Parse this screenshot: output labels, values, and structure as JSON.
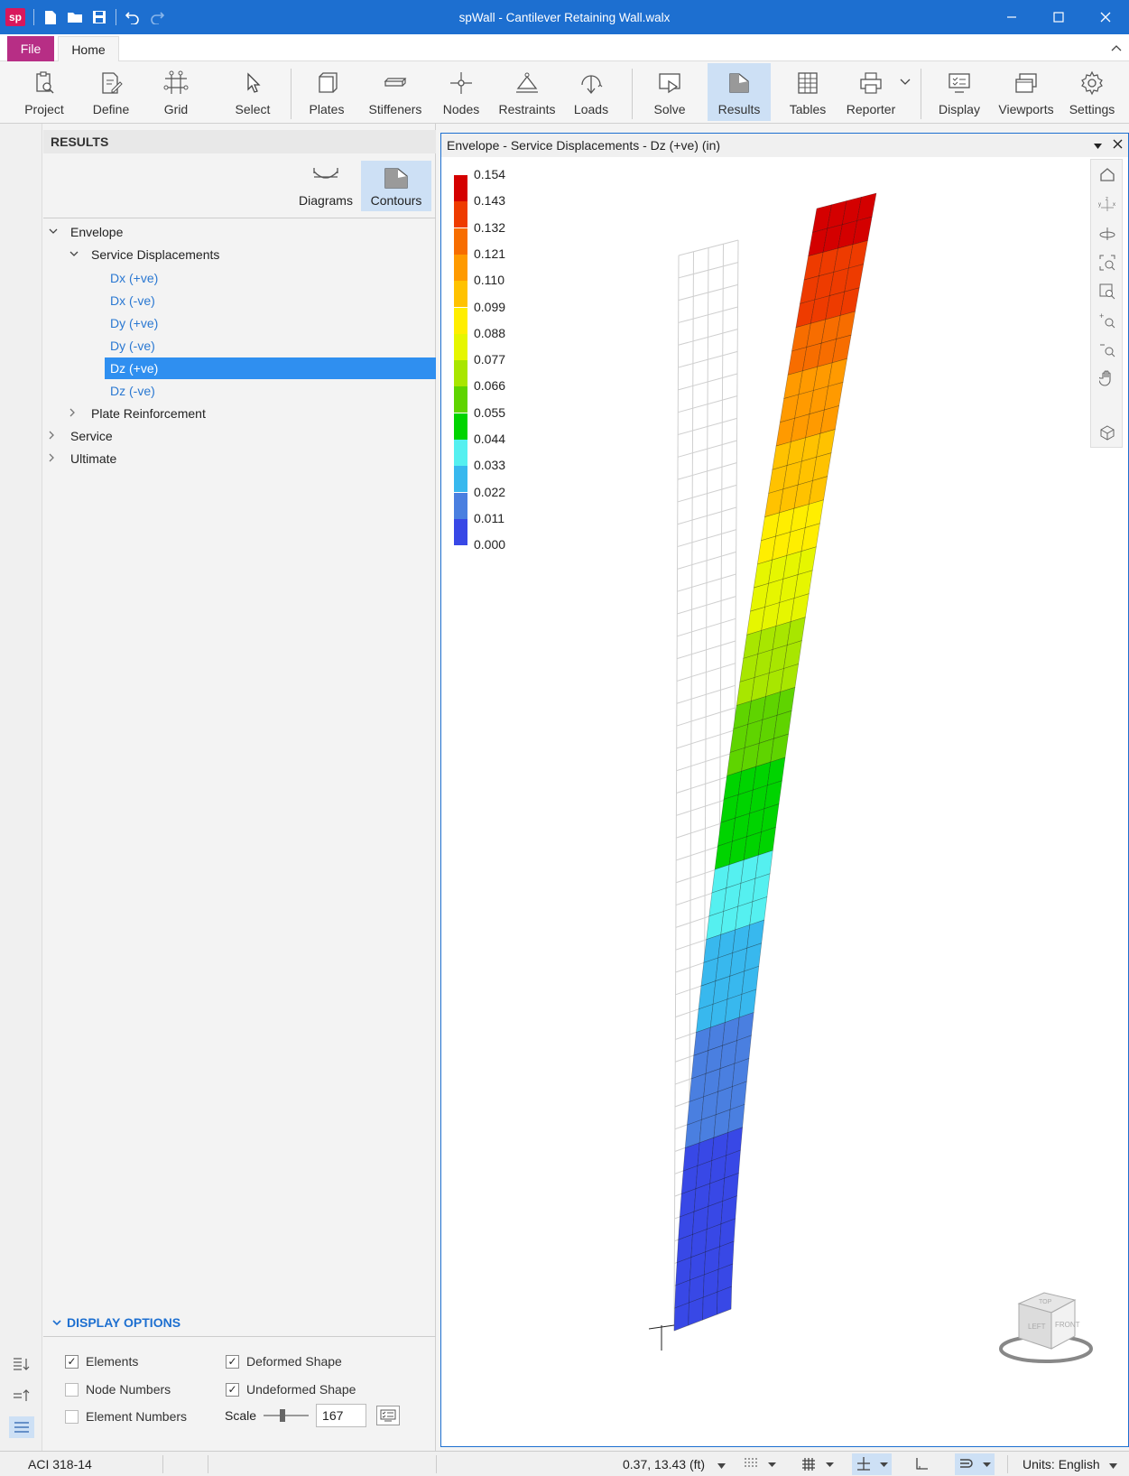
{
  "titlebar": {
    "title": "spWall - Cantilever Retaining Wall.walx",
    "logo": "sp",
    "quick_access_icons": [
      "new-file-icon",
      "open-folder-icon",
      "save-icon",
      "undo-icon",
      "redo-icon"
    ]
  },
  "tabs": {
    "file": "File",
    "home": "Home"
  },
  "ribbon": {
    "buttons": [
      {
        "label": "Project",
        "icon": "clipboard-search-icon"
      },
      {
        "label": "Define",
        "icon": "define-icon"
      },
      {
        "label": "Grid",
        "icon": "grid-icon"
      },
      {
        "label": "Select",
        "icon": "pointer-icon"
      },
      {
        "label": "Plates",
        "icon": "plate-icon"
      },
      {
        "label": "Stiffeners",
        "icon": "stiffener-icon"
      },
      {
        "label": "Nodes",
        "icon": "node-icon"
      },
      {
        "label": "Restraints",
        "icon": "restraint-icon"
      },
      {
        "label": "Loads",
        "icon": "load-icon"
      },
      {
        "label": "Solve",
        "icon": "solve-icon"
      },
      {
        "label": "Results",
        "icon": "results-icon"
      },
      {
        "label": "Tables",
        "icon": "table-icon"
      },
      {
        "label": "Reporter",
        "icon": "printer-icon"
      },
      {
        "label": "Display",
        "icon": "display-icon"
      },
      {
        "label": "Viewports",
        "icon": "viewports-icon"
      },
      {
        "label": "Settings",
        "icon": "gear-icon"
      }
    ],
    "active": "Results"
  },
  "results_panel": {
    "header": "RESULTS",
    "modes": [
      {
        "label": "Diagrams"
      },
      {
        "label": "Contours"
      }
    ],
    "active_mode": "Contours",
    "tree": {
      "envelope": "Envelope",
      "service_displacements": "Service Displacements",
      "leaves": [
        "Dx (+ve)",
        "Dx (-ve)",
        "Dy (+ve)",
        "Dy (-ve)",
        "Dz (+ve)",
        "Dz (-ve)"
      ],
      "selected": "Dz (+ve)",
      "plate_reinforcement": "Plate Reinforcement",
      "service": "Service",
      "ultimate": "Ultimate"
    },
    "display_options": {
      "title": "DISPLAY OPTIONS",
      "elements": {
        "label": "Elements",
        "checked": true
      },
      "node_numbers": {
        "label": "Node Numbers",
        "checked": false
      },
      "element_numbers": {
        "label": "Element Numbers",
        "checked": false
      },
      "deformed_shape": {
        "label": "Deformed Shape",
        "checked": true
      },
      "undeformed_shape": {
        "label": "Undeformed Shape",
        "checked": true
      },
      "scale_label": "Scale",
      "scale_value": "167"
    }
  },
  "viewport": {
    "title": "Envelope - Service Displacements - Dz (+ve) (in)",
    "legend": {
      "values": [
        "0.154",
        "0.143",
        "0.132",
        "0.121",
        "0.110",
        "0.099",
        "0.088",
        "0.077",
        "0.066",
        "0.055",
        "0.044",
        "0.033",
        "0.022",
        "0.011",
        "0.000"
      ],
      "colors": [
        "#d40000",
        "#ee3b00",
        "#f76d00",
        "#ff9a00",
        "#ffc200",
        "#ffee00",
        "#e6f600",
        "#a8e600",
        "#5fd400",
        "#00d400",
        "#55f0f0",
        "#38b8ee",
        "#4a7fe0",
        "#3848e6",
        "#0c10f0"
      ]
    },
    "tools": [
      "home-icon",
      "axes-icon",
      "rotate-icon",
      "zoom-extents-icon",
      "zoom-window-icon",
      "zoom-in-icon",
      "zoom-out-icon",
      "pan-hand-icon",
      "cube-view-icon"
    ],
    "view_cube": {
      "faces": [
        "TOP",
        "LEFT",
        "FRONT"
      ]
    }
  },
  "statusbar": {
    "code": "ACI 318-14",
    "coords": "0.37, 13.43 (ft)",
    "units_label": "Units:",
    "units_value": "English"
  }
}
